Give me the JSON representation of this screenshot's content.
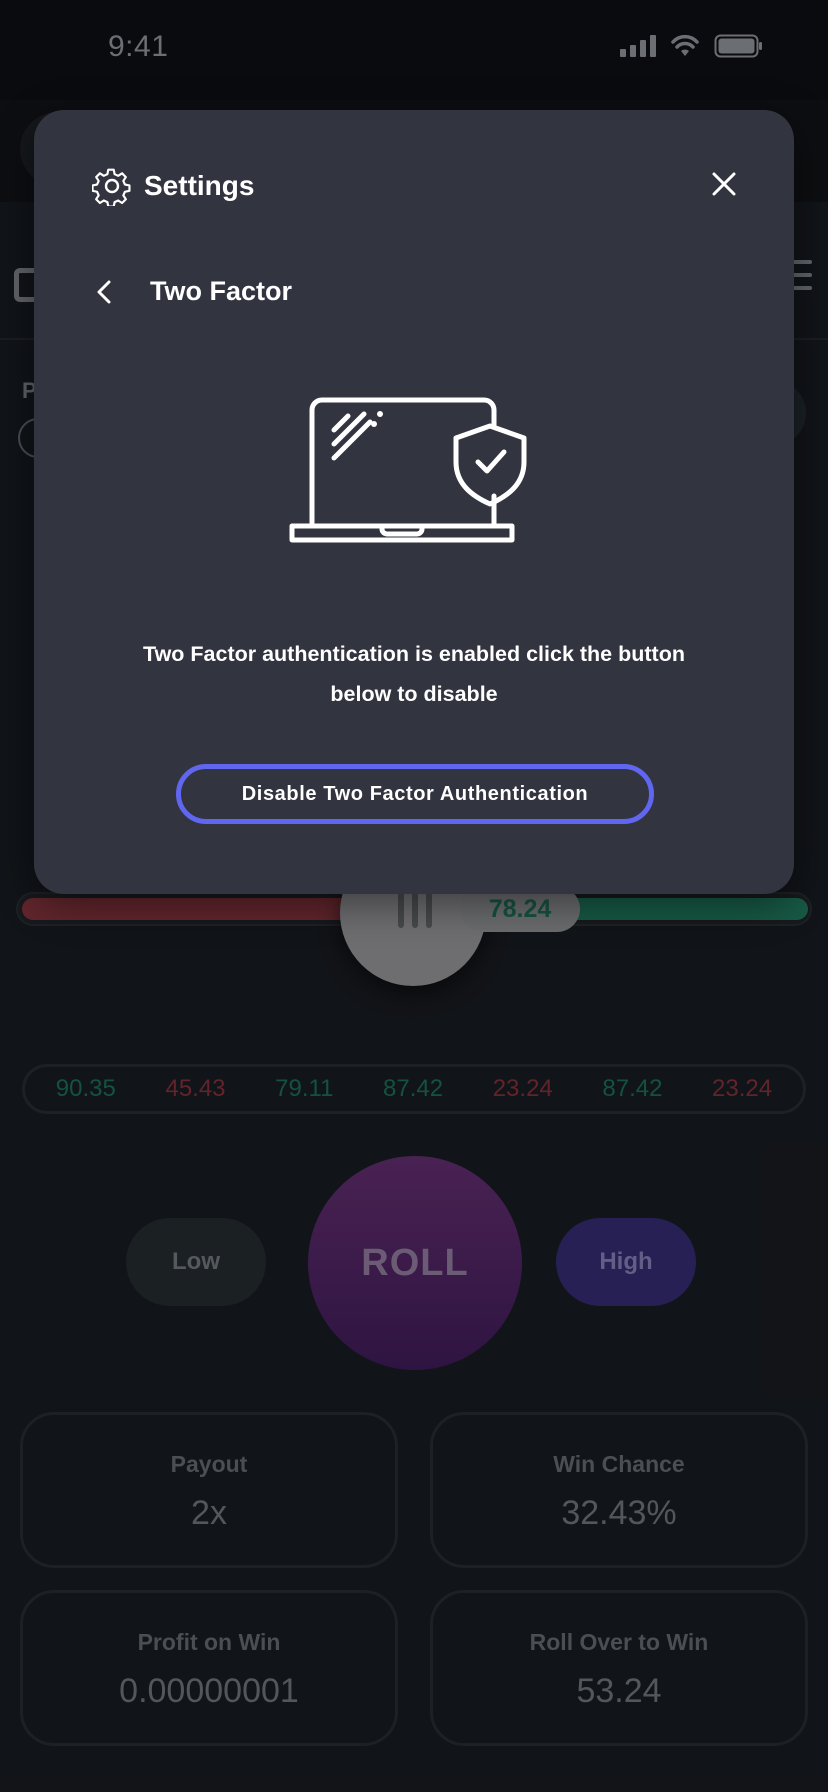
{
  "status_bar": {
    "time": "9:41"
  },
  "slider": {
    "value": "78.24",
    "fill_percent": 78.24
  },
  "history": [
    {
      "value": "90.35",
      "status": "green"
    },
    {
      "value": "45.43",
      "status": "red"
    },
    {
      "value": "79.11",
      "status": "green"
    },
    {
      "value": "87.42",
      "status": "green"
    },
    {
      "value": "23.24",
      "status": "red"
    },
    {
      "value": "87.42",
      "status": "green"
    },
    {
      "value": "23.24",
      "status": "red"
    }
  ],
  "controls": {
    "low_label": "Low",
    "roll_label": "ROLL",
    "high_label": "High"
  },
  "stats": {
    "payout": {
      "label": "Payout",
      "value": "2x"
    },
    "win_chance": {
      "label": "Win Chance",
      "value": "32.43%"
    },
    "profit": {
      "label": "Profit on Win",
      "value": "0.00000001"
    },
    "roll_over": {
      "label": "Roll Over to Win",
      "value": "53.24"
    }
  },
  "modal": {
    "title": "Settings",
    "subtitle": "Two Factor",
    "message_line1": "Two Factor authentication is enabled click the button",
    "message_line2": "below to disable",
    "button_label": "Disable Two Factor Authentication"
  },
  "colors": {
    "modal_bg": "#32343f",
    "button_border": "#6166f0",
    "win_green": "#1a6a52",
    "loss_red": "#7d2f37",
    "roll_purple": "#4a2160",
    "high_blue": "#312a6c"
  },
  "icons": {
    "settings": "gear-icon",
    "close": "close-icon",
    "back": "chevron-left-icon",
    "illustration": "laptop-shield-icon"
  }
}
